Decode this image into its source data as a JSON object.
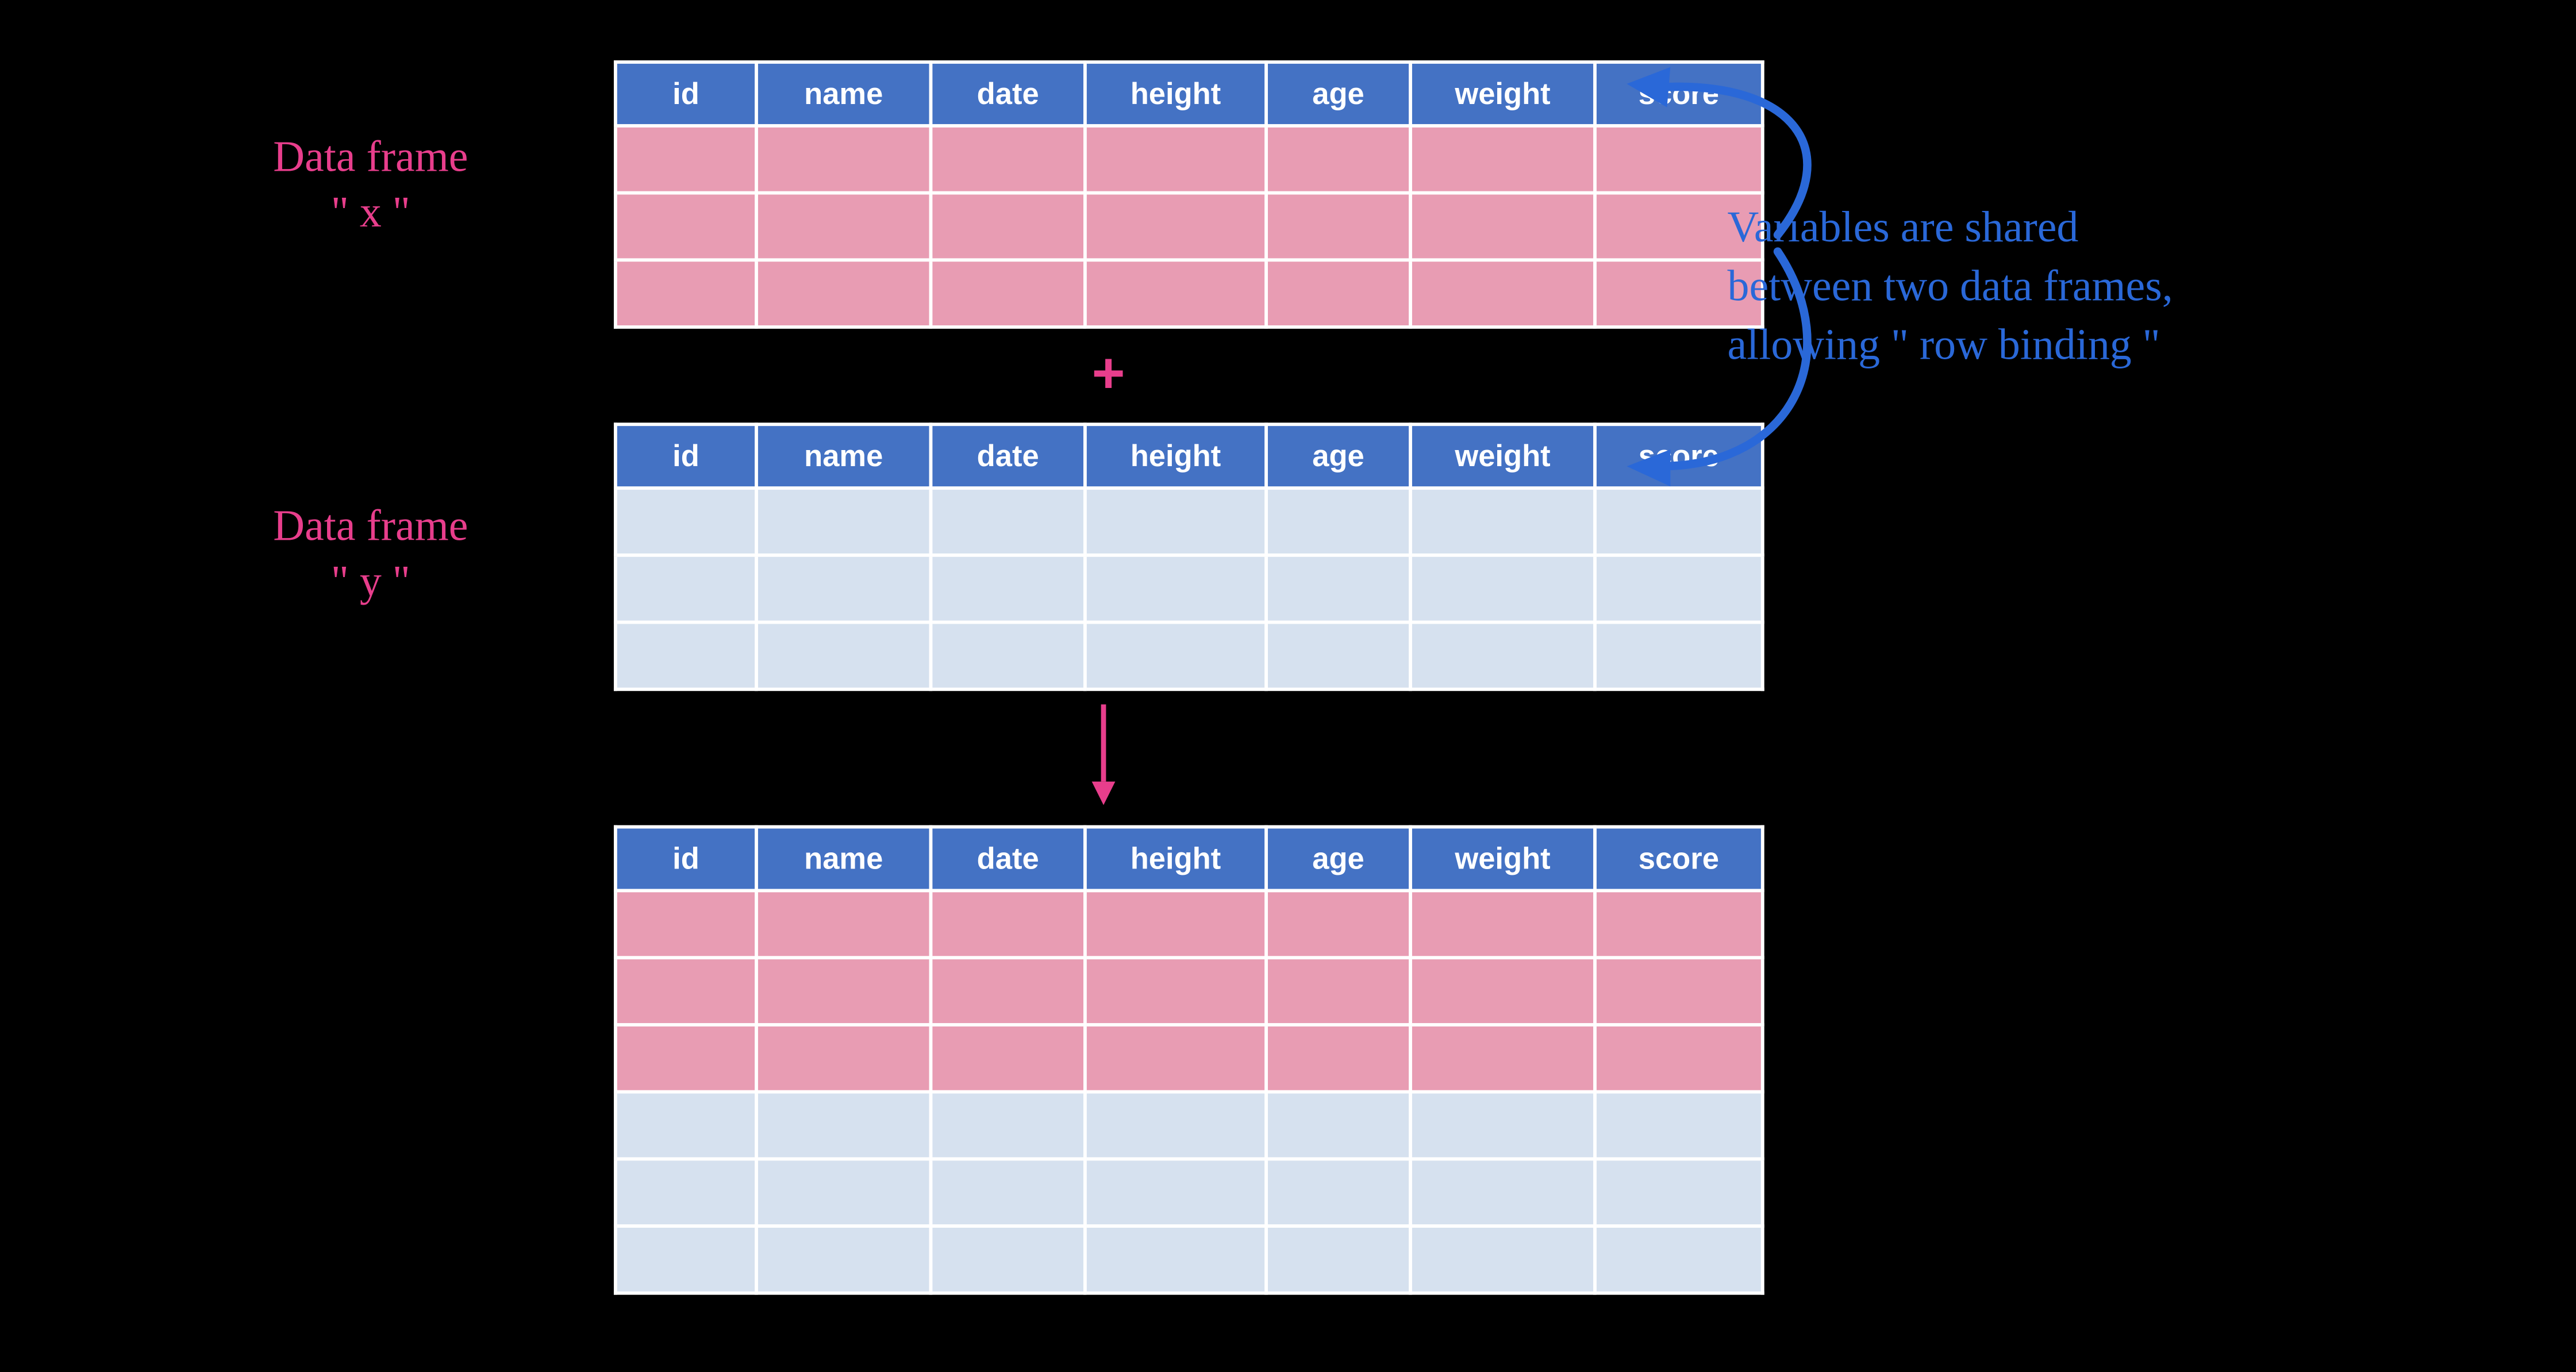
{
  "columns": [
    "id",
    "name",
    "date",
    "height",
    "age",
    "weight",
    "score"
  ],
  "labels": {
    "x_line1": "Data frame",
    "x_line2": "\" x \"",
    "y_line1": "Data frame",
    "y_line2": "\" y \""
  },
  "plus": "+",
  "annotation": {
    "line1": "Variables are shared",
    "line2": "between two data frames,",
    "line3": "allowing  \" row  binding \""
  },
  "tables": {
    "x": {
      "pink_rows": 3,
      "blue_rows": 0
    },
    "y": {
      "pink_rows": 0,
      "blue_rows": 3
    },
    "result": {
      "pink_rows": 3,
      "blue_rows": 3
    }
  },
  "colors": {
    "header": "#4472c4",
    "pink": "#e89cb3",
    "blue": "#d6e1ef",
    "accent": "#e83e8c",
    "note": "#2a68d8",
    "bg": "#000000"
  }
}
